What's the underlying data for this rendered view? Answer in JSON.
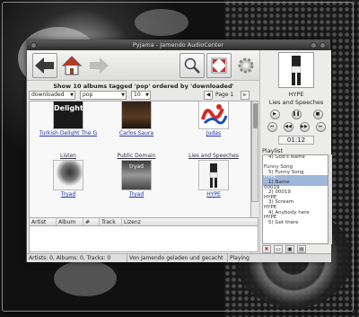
{
  "window": {
    "title": "Pyjama - Jamendo AudioCenter"
  },
  "toolbar": {
    "back_icon": "arrow-left-icon",
    "home_icon": "house-icon",
    "forward_icon": "arrow-right-icon",
    "search_icon": "magnifier-icon",
    "fullscreen_icon": "fullscreen-icon",
    "settings_icon": "gear-icon"
  },
  "browser": {
    "heading": "Show 10 albums tagged 'pop' ordered by 'downloaded'",
    "order_value": "downloaded",
    "tag_value": "pop",
    "count_value": "10",
    "page_label": "Page 1"
  },
  "albums": [
    {
      "caption": "",
      "name": "Turkish Delight The G"
    },
    {
      "caption": "",
      "name": "Carlos Saura"
    },
    {
      "caption": "",
      "name": "Judas"
    },
    {
      "caption": "Listen",
      "name": "Tryad"
    },
    {
      "caption": "Public Domain",
      "name": "Tryad"
    },
    {
      "caption": "Lies and Speeches",
      "name": "HYPE"
    }
  ],
  "cover_text": {
    "delight": "Delight",
    "tryad": "tryad"
  },
  "tracks": {
    "columns": [
      "Artist",
      "Album",
      "#",
      "Track",
      "Lizenz"
    ]
  },
  "status": {
    "counts": "Artists: 0, Albums: 0, Tracks: 0",
    "message": "Von Jamendo geladen und gecacht",
    "state": "Playing"
  },
  "nowplaying": {
    "artist": "HYPE",
    "album": "Lies and Speeches",
    "time": "01:12"
  },
  "playlist": {
    "label": "Playlist",
    "items": [
      {
        "artist": "",
        "title": "4) God's Name"
      },
      {
        "artist": "Funny Song",
        "title": "5) Funny Song"
      },
      {
        "artist": "HYPE",
        "title": "1) Name"
      },
      {
        "artist": "00019",
        "title": "2) 00019"
      },
      {
        "artist": "HYPE",
        "title": "3) Scream"
      },
      {
        "artist": "HYPE",
        "title": "4) Anybody here"
      },
      {
        "artist": "HYPE",
        "title": "5) Get there"
      }
    ],
    "selected_index": 2
  }
}
